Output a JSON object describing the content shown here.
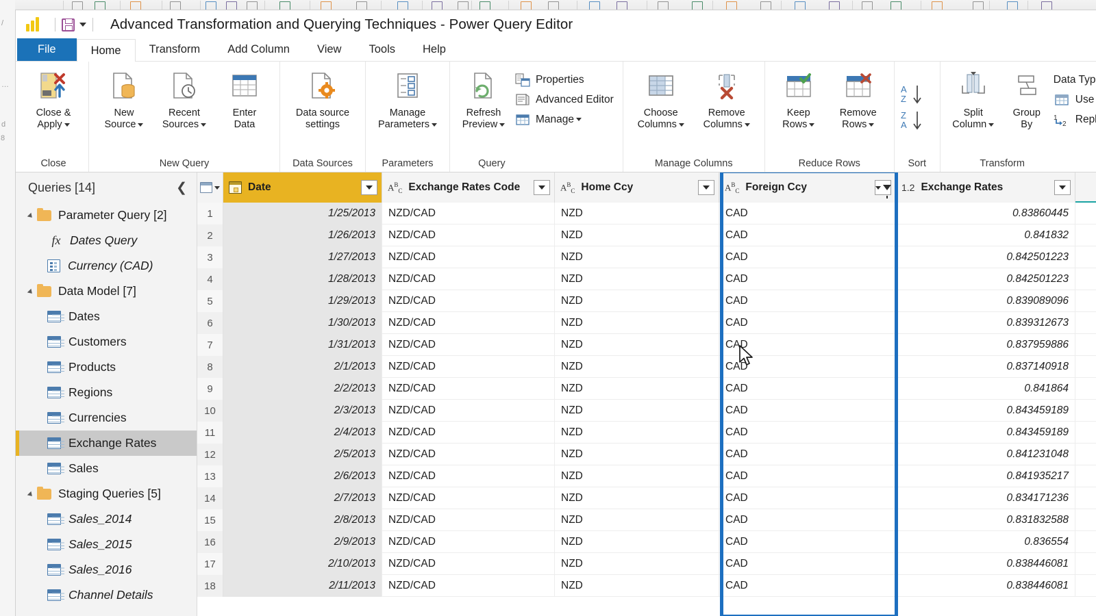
{
  "window": {
    "title": "Advanced Transformation and Querying Techniques - Power Query Editor",
    "logo_icon": "power-bi-logo-icon",
    "save_icon": "save-icon",
    "qat_caret_icon": "chevron-down-icon"
  },
  "ribbon": {
    "tabs": [
      {
        "label": "File",
        "state": "file"
      },
      {
        "label": "Home",
        "state": "active"
      },
      {
        "label": "Transform",
        "state": "normal"
      },
      {
        "label": "Add Column",
        "state": "normal"
      },
      {
        "label": "View",
        "state": "normal"
      },
      {
        "label": "Tools",
        "state": "normal"
      },
      {
        "label": "Help",
        "state": "normal"
      }
    ],
    "groups": [
      {
        "name": "Close",
        "buttons": [
          {
            "label_line1": "Close &",
            "label_line2": "Apply",
            "icon": "close-and-apply-icon",
            "caret": true
          }
        ]
      },
      {
        "name": "New Query",
        "buttons": [
          {
            "label_line1": "New",
            "label_line2": "Source",
            "icon": "new-source-icon",
            "caret": true
          },
          {
            "label_line1": "Recent",
            "label_line2": "Sources",
            "icon": "recent-sources-icon",
            "caret": true
          },
          {
            "label_line1": "Enter",
            "label_line2": "Data",
            "icon": "enter-data-icon",
            "caret": false
          }
        ]
      },
      {
        "name": "Data Sources",
        "buttons": [
          {
            "label_line1": "Data source",
            "label_line2": "settings",
            "icon": "data-source-settings-icon",
            "caret": false
          }
        ]
      },
      {
        "name": "Parameters",
        "buttons": [
          {
            "label_line1": "Manage",
            "label_line2": "Parameters",
            "icon": "manage-parameters-icon",
            "caret": true
          }
        ]
      },
      {
        "name": "Query",
        "buttons": [
          {
            "label_line1": "Refresh",
            "label_line2": "Preview",
            "icon": "refresh-preview-icon",
            "caret": true
          }
        ],
        "small_buttons": [
          {
            "label": "Properties",
            "icon": "properties-icon",
            "caret": false
          },
          {
            "label": "Advanced Editor",
            "icon": "advanced-editor-icon",
            "caret": false
          },
          {
            "label": "Manage",
            "icon": "manage-icon",
            "caret": true
          }
        ]
      },
      {
        "name": "Manage Columns",
        "buttons": [
          {
            "label_line1": "Choose",
            "label_line2": "Columns",
            "icon": "choose-columns-icon",
            "caret": true
          },
          {
            "label_line1": "Remove",
            "label_line2": "Columns",
            "icon": "remove-columns-icon",
            "caret": true
          }
        ]
      },
      {
        "name": "Reduce Rows",
        "buttons": [
          {
            "label_line1": "Keep",
            "label_line2": "Rows",
            "icon": "keep-rows-icon",
            "caret": true
          },
          {
            "label_line1": "Remove",
            "label_line2": "Rows",
            "icon": "remove-rows-icon",
            "caret": true
          }
        ]
      },
      {
        "name": "Sort",
        "sort_buttons": [
          {
            "label": "AZ",
            "icon": "sort-ascending-icon"
          },
          {
            "label": "ZA",
            "icon": "sort-descending-icon"
          }
        ]
      },
      {
        "name": "Transform",
        "buttons": [
          {
            "label_line1": "Split",
            "label_line2": "Column",
            "icon": "split-column-icon",
            "caret": true
          },
          {
            "label_line1": "Group",
            "label_line2": "By",
            "icon": "group-by-icon",
            "caret": false
          }
        ],
        "small_buttons": [
          {
            "label": "Data Type: Date",
            "icon": "data-type-icon",
            "caret": true
          },
          {
            "label": "Use First Row as Headers",
            "icon": "use-first-row-icon",
            "caret": false
          },
          {
            "label": "Replace Values",
            "icon": "replace-values-icon",
            "caret": false
          }
        ]
      }
    ]
  },
  "sidebar": {
    "title": "Queries [14]",
    "collapse_icon": "chevron-left-icon",
    "items": [
      {
        "label": "Parameter Query [2]",
        "type": "folder",
        "indent": 0,
        "italic": false,
        "selected": false
      },
      {
        "label": "Dates Query",
        "type": "fx",
        "indent": 1,
        "italic": true,
        "selected": false
      },
      {
        "label": "Currency (CAD)",
        "type": "param",
        "indent": 1,
        "italic": true,
        "selected": false
      },
      {
        "label": "Data Model [7]",
        "type": "folder",
        "indent": 0,
        "italic": false,
        "selected": false
      },
      {
        "label": "Dates",
        "type": "table",
        "indent": 1,
        "italic": false,
        "selected": false
      },
      {
        "label": "Customers",
        "type": "table",
        "indent": 1,
        "italic": false,
        "selected": false
      },
      {
        "label": "Products",
        "type": "table",
        "indent": 1,
        "italic": false,
        "selected": false
      },
      {
        "label": "Regions",
        "type": "table",
        "indent": 1,
        "italic": false,
        "selected": false
      },
      {
        "label": "Currencies",
        "type": "table",
        "indent": 1,
        "italic": false,
        "selected": false
      },
      {
        "label": "Exchange Rates",
        "type": "table",
        "indent": 1,
        "italic": false,
        "selected": true
      },
      {
        "label": "Sales",
        "type": "table",
        "indent": 1,
        "italic": false,
        "selected": false
      },
      {
        "label": "Staging Queries [5]",
        "type": "folder",
        "indent": 0,
        "italic": false,
        "selected": false
      },
      {
        "label": "Sales_2014",
        "type": "table",
        "indent": 1,
        "italic": true,
        "selected": false
      },
      {
        "label": "Sales_2015",
        "type": "table",
        "indent": 1,
        "italic": true,
        "selected": false
      },
      {
        "label": "Sales_2016",
        "type": "table",
        "indent": 1,
        "italic": true,
        "selected": false
      },
      {
        "label": "Channel Details",
        "type": "table",
        "indent": 1,
        "italic": true,
        "selected": false
      }
    ]
  },
  "grid": {
    "columns": [
      {
        "name": "Date",
        "type_icon": "date-type-icon",
        "type_label": "",
        "width_class": "w-date",
        "header_bg": "gold",
        "align": "right",
        "filtered": false
      },
      {
        "name": "Exchange Rates Code",
        "type_icon": "text-type-icon",
        "type_label": "ABC",
        "width_class": "w-code",
        "header_bg": "plain",
        "align": "left",
        "filtered": false
      },
      {
        "name": "Home Ccy",
        "type_icon": "text-type-icon",
        "type_label": "ABC",
        "width_class": "w-home",
        "header_bg": "plain",
        "align": "left",
        "filtered": false
      },
      {
        "name": "Foreign Ccy",
        "type_icon": "text-type-icon",
        "type_label": "ABC",
        "width_class": "w-fgn",
        "header_bg": "plain",
        "align": "left",
        "filtered": true
      },
      {
        "name": "Exchange Rates",
        "type_icon": "decimal-type-icon",
        "type_label": "1.2",
        "width_class": "w-rate",
        "header_bg": "plain",
        "align": "right",
        "filtered": false
      }
    ],
    "rows": [
      {
        "n": "1",
        "date": "1/25/2013",
        "code": "NZD/CAD",
        "home": "NZD",
        "foreign": "CAD",
        "rate": "0.83860445"
      },
      {
        "n": "2",
        "date": "1/26/2013",
        "code": "NZD/CAD",
        "home": "NZD",
        "foreign": "CAD",
        "rate": "0.841832"
      },
      {
        "n": "3",
        "date": "1/27/2013",
        "code": "NZD/CAD",
        "home": "NZD",
        "foreign": "CAD",
        "rate": "0.842501223"
      },
      {
        "n": "4",
        "date": "1/28/2013",
        "code": "NZD/CAD",
        "home": "NZD",
        "foreign": "CAD",
        "rate": "0.842501223"
      },
      {
        "n": "5",
        "date": "1/29/2013",
        "code": "NZD/CAD",
        "home": "NZD",
        "foreign": "CAD",
        "rate": "0.839089096"
      },
      {
        "n": "6",
        "date": "1/30/2013",
        "code": "NZD/CAD",
        "home": "NZD",
        "foreign": "CAD",
        "rate": "0.839312673"
      },
      {
        "n": "7",
        "date": "1/31/2013",
        "code": "NZD/CAD",
        "home": "NZD",
        "foreign": "CAD",
        "rate": "0.837959886"
      },
      {
        "n": "8",
        "date": "2/1/2013",
        "code": "NZD/CAD",
        "home": "NZD",
        "foreign": "CAD",
        "rate": "0.837140918"
      },
      {
        "n": "9",
        "date": "2/2/2013",
        "code": "NZD/CAD",
        "home": "NZD",
        "foreign": "CAD",
        "rate": "0.841864"
      },
      {
        "n": "10",
        "date": "2/3/2013",
        "code": "NZD/CAD",
        "home": "NZD",
        "foreign": "CAD",
        "rate": "0.843459189"
      },
      {
        "n": "11",
        "date": "2/4/2013",
        "code": "NZD/CAD",
        "home": "NZD",
        "foreign": "CAD",
        "rate": "0.843459189"
      },
      {
        "n": "12",
        "date": "2/5/2013",
        "code": "NZD/CAD",
        "home": "NZD",
        "foreign": "CAD",
        "rate": "0.841231048"
      },
      {
        "n": "13",
        "date": "2/6/2013",
        "code": "NZD/CAD",
        "home": "NZD",
        "foreign": "CAD",
        "rate": "0.841935217"
      },
      {
        "n": "14",
        "date": "2/7/2013",
        "code": "NZD/CAD",
        "home": "NZD",
        "foreign": "CAD",
        "rate": "0.834171236"
      },
      {
        "n": "15",
        "date": "2/8/2013",
        "code": "NZD/CAD",
        "home": "NZD",
        "foreign": "CAD",
        "rate": "0.831832588"
      },
      {
        "n": "16",
        "date": "2/9/2013",
        "code": "NZD/CAD",
        "home": "NZD",
        "foreign": "CAD",
        "rate": "0.836554"
      },
      {
        "n": "17",
        "date": "2/10/2013",
        "code": "NZD/CAD",
        "home": "NZD",
        "foreign": "CAD",
        "rate": "0.838446081"
      },
      {
        "n": "18",
        "date": "2/11/2013",
        "code": "NZD/CAD",
        "home": "NZD",
        "foreign": "CAD",
        "rate": "0.838446081"
      }
    ]
  },
  "annotation": {
    "highlight_color": "#1D6FC0",
    "highlight_target": "Foreign Ccy"
  },
  "colors": {
    "accent_gold": "#E8B322",
    "header_underline_teal": "#1AA3A3",
    "file_tab_blue": "#1B72B8",
    "selection_gray": "#C9C9C9"
  }
}
